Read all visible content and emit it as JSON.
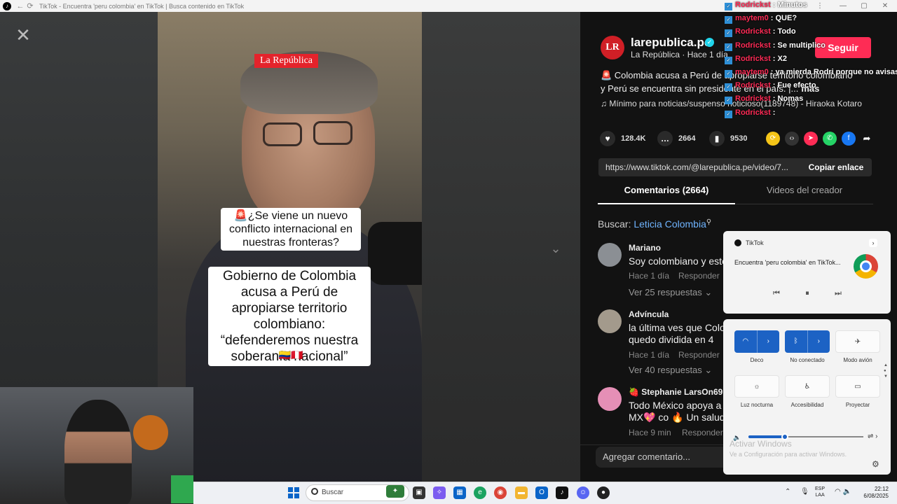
{
  "browser": {
    "title": "TikTok - Encuentra 'peru colombia' en TikTok | Busca contenido en TikTok",
    "back_glyph": "←",
    "reload_glyph": "⟳",
    "menu_glyph": "⋮",
    "minimize_glyph": "—",
    "maximize_glyph": "▢",
    "close_glyph": "✕"
  },
  "video": {
    "close_glyph": "✕",
    "brand_tag": "La República",
    "caption_1": "🚨¿Se viene un nuevo conflicto internacional en nuestras fronteras?",
    "caption_2": "Gobierno de Colombia acusa a Perú de apropiarse territorio colombiano: “defenderemos nuestra soberanía nacional”",
    "caption_flags": "🇨🇴🇵🇪",
    "scroll_glyph": "⌄"
  },
  "post": {
    "avatar_text": "LR",
    "channel_name": "larepublica.pe",
    "verified_glyph": "✓",
    "channel_sub": "La República · Hace 1 día",
    "follow_label": "Seguir",
    "description_line1": "🚨 Colombia acusa a Perú de apropiarse territorio colombiano",
    "description_line2": "y Perú se encuentra sin presidente en el país. |...",
    "description_more": "más",
    "music": "♫  Mínimo para noticias/suspenso noticioso(1189748) - Hiraoka Kotaro",
    "likes": "128.4K",
    "comments": "2664",
    "saves": "9530",
    "link_url": "https://www.tiktok.com/@larepublica.pe/video/7...",
    "copy_link_label": "Copiar enlace"
  },
  "tabs": [
    {
      "label": "Comentarios (2664)"
    },
    {
      "label": "Videos del creador"
    }
  ],
  "search_suggestion": {
    "prefix": "Buscar:",
    "keyword": "Leticia Colombia"
  },
  "comments": [
    {
      "name": "Mariano",
      "text": "Soy colombiano y esto",
      "meta": "Hace 1 día",
      "reply": "Responder",
      "replies": "Ver 25 respuestas ⌄",
      "avatar_color": "#8b8f94"
    },
    {
      "name": "Advíncula",
      "text": "la última ves que Colo",
      "text2": "quedo dividida en 4",
      "meta": "Hace 1 día",
      "reply": "Responder",
      "replies": "Ver 40 respuestas ⌄",
      "avatar_color": "#a39a8c"
    },
    {
      "name": "🍓 Stephanie LarsOn69",
      "text": "Todo México apoya a",
      "text2": "MX💖 co 🔥 Un saludito",
      "meta": "Hace 9 min",
      "reply": "Responder",
      "avatar_color": "#e58fb6"
    }
  ],
  "comment_input_placeholder": "Agregar comentario...",
  "chat": [
    {
      "user": "Rodrickst",
      "msg": "Minutos",
      "user_color": "#ff2a55"
    },
    {
      "user": "maytem0",
      "msg": "QUE?",
      "user_color": "#ff2a55"
    },
    {
      "user": "Rodrickst",
      "msg": "Todo",
      "user_color": "#ff2a55"
    },
    {
      "user": "Rodrickst",
      "msg": "Se multiplico",
      "user_color": "#ff2a55"
    },
    {
      "user": "Rodrickst",
      "msg": "X2",
      "user_color": "#ff2a55"
    },
    {
      "user": "maytem0",
      "msg": "ya mierda Rodri porque no avisas",
      "user_color": "#ff2a55"
    },
    {
      "user": "Rodrickst",
      "msg": "Fue efecto",
      "user_color": "#ff2a55"
    },
    {
      "user": "Rodrickst",
      "msg": "Nomas",
      "user_color": "#ff2a55"
    },
    {
      "user": "Rodrickst",
      "msg": "",
      "user_color": "#ff2a55"
    }
  ],
  "media": {
    "app": "TikTok",
    "title": "Encuentra 'peru colombia' en TikTok...",
    "prev_glyph": "⏮",
    "pause_glyph": "⏸",
    "next_glyph": "⏭",
    "expand_glyph": "›"
  },
  "quick_settings": {
    "tiles": [
      {
        "label": "Deco",
        "icon": "wifi-icon",
        "glyph": "◠",
        "on": true
      },
      {
        "label": "No conectado",
        "icon": "bluetooth-icon",
        "glyph": "ᛒ",
        "on": true
      },
      {
        "label": "Modo avión",
        "icon": "airplane-icon",
        "glyph": "✈",
        "on": false
      },
      {
        "label": "Luz nocturna",
        "icon": "night-light-icon",
        "glyph": "☼",
        "on": false
      },
      {
        "label": "Accesibilidad",
        "icon": "accessibility-icon",
        "glyph": "♿",
        "on": false
      },
      {
        "label": "Proyectar",
        "icon": "cast-icon",
        "glyph": "▭",
        "on": false
      }
    ],
    "volume_level": 0.32,
    "volume_glyph": "🔈",
    "output_glyph": "⇌ ›",
    "settings_glyph": "⚙",
    "activate_title": "Activar Windows",
    "activate_sub": "Ve a Configuración para activar Windows."
  },
  "taskbar": {
    "search_placeholder": "Buscar",
    "lang_1": "ESP",
    "lang_2": "LAA",
    "time": "22:12",
    "date": "6/08/2025",
    "tray_chevron": "⌃",
    "mic_glyph": "🎙",
    "net_glyph": "◠ 🔈"
  }
}
